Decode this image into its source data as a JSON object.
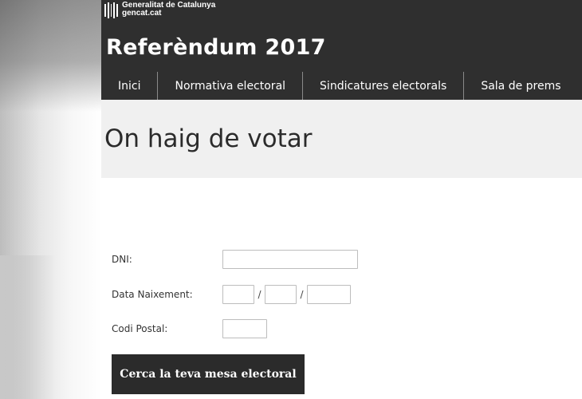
{
  "header": {
    "gov_name": "Generalitat de Catalunya",
    "gov_site": "gencat.cat",
    "site_title": "Referèndum 2017",
    "bg_color": "#2f2f2f"
  },
  "nav": {
    "items": [
      {
        "label": "Inici"
      },
      {
        "label": "Normativa electoral"
      },
      {
        "label": "Sindicatures electorals"
      },
      {
        "label": "Sala de prems"
      }
    ]
  },
  "page": {
    "title": "On haig de votar"
  },
  "form": {
    "dni_label": "DNI:",
    "dni_value": "",
    "birth_label": "Data Naixement:",
    "birth_day": "",
    "birth_month": "",
    "birth_year": "",
    "date_sep": "/",
    "postal_label": "Codi Postal:",
    "postal_value": "",
    "submit_label": "Cerca la teva mesa electoral"
  }
}
